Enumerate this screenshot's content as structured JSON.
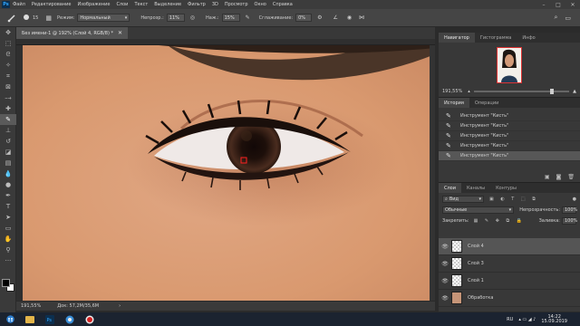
{
  "app": {
    "logo": "Ps"
  },
  "menu": [
    "Файл",
    "Редактирование",
    "Изображение",
    "Слои",
    "Текст",
    "Выделение",
    "Фильтр",
    "3D",
    "Просмотр",
    "Окно",
    "Справка"
  ],
  "options": {
    "mode_label": "Режим:",
    "mode_value": "Нормальный",
    "opacity_label": "Непрозр.:",
    "opacity_value": "11%",
    "flow_label": "Наж.:",
    "flow_value": "15%",
    "smoothing_label": "Сглаживание:",
    "smoothing_value": "0%",
    "brush_size": "15"
  },
  "document": {
    "tab_title": "Без имени-1 @ 192% (Слой 4, RGB/8) *",
    "status_zoom": "191,55%",
    "status_doc": "Док: 57,2M/35,6M"
  },
  "navigator": {
    "tabs": [
      "Навигатор",
      "Гистограмма",
      "Инфо"
    ],
    "zoom": "191,55%"
  },
  "history": {
    "tabs": [
      "История",
      "Операции"
    ],
    "items": [
      "Инструмент \"Кисть\"",
      "Инструмент \"Кисть\"",
      "Инструмент \"Кисть\"",
      "Инструмент \"Кисть\"",
      "Инструмент \"Кисть\""
    ],
    "selected_index": 4
  },
  "layers": {
    "tabs": [
      "Слои",
      "Каналы",
      "Контуры"
    ],
    "filter_label": "Вид",
    "blend_mode": "Обычные",
    "opacity_label": "Непрозрачность:",
    "opacity_value": "100%",
    "lock_label": "Закрепить:",
    "fill_label": "Заливка:",
    "fill_value": "100%",
    "items": [
      {
        "name": "Слой 4",
        "selected": true,
        "photo": false
      },
      {
        "name": "Слой 3",
        "selected": false,
        "photo": false
      },
      {
        "name": "Слой 1",
        "selected": false,
        "photo": false
      },
      {
        "name": "Обработка",
        "selected": false,
        "photo": true
      }
    ]
  },
  "taskbar": {
    "lang": "RU",
    "time": "14:22",
    "date": "15.09.2019"
  },
  "colors": {
    "accent": "#31a8ff",
    "record": "#d32020"
  }
}
